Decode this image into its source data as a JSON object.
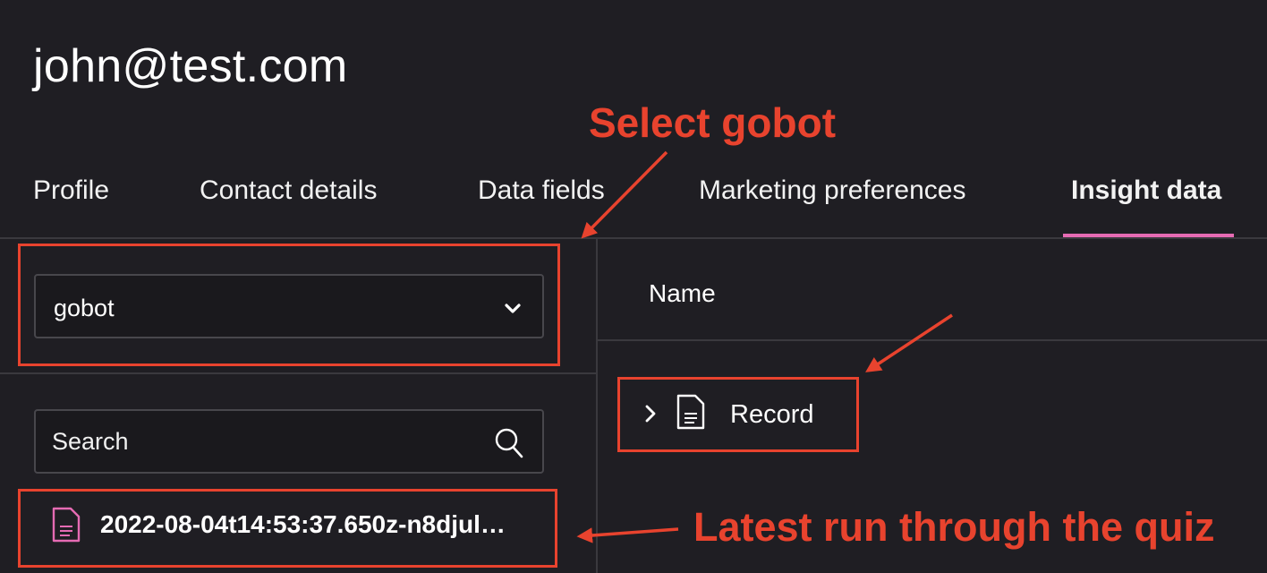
{
  "header": {
    "title": "john@test.com"
  },
  "tabs": [
    {
      "label": "Profile"
    },
    {
      "label": "Contact details"
    },
    {
      "label": "Data fields"
    },
    {
      "label": "Marketing preferences"
    },
    {
      "label": "Insight data",
      "active": true
    }
  ],
  "sidebar": {
    "select": {
      "value": "gobot"
    },
    "search": {
      "placeholder": "Search"
    },
    "runs": [
      {
        "label": "2022-08-04t14:53:37.650z-n8djul…"
      }
    ]
  },
  "main": {
    "column_header": "Name",
    "rows": [
      {
        "label": "Record"
      }
    ]
  },
  "annotations": {
    "select_gobot": "Select gobot",
    "latest_run": "Latest run through the quiz"
  },
  "colors": {
    "accent": "#e56bb3",
    "annotation": "#e8432e",
    "background": "#1f1e23"
  }
}
